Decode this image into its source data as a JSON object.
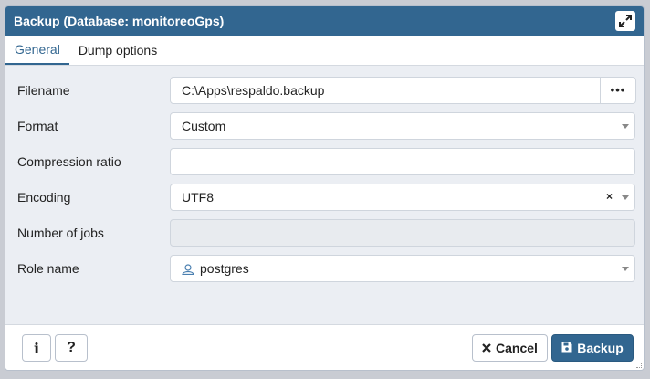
{
  "dialog": {
    "title": "Backup (Database: monitoreoGps)"
  },
  "tabs": [
    {
      "label": "General"
    },
    {
      "label": "Dump options"
    }
  ],
  "form": {
    "filename": {
      "label": "Filename",
      "value": "C:\\Apps\\respaldo.backup",
      "browse_label": "•••"
    },
    "format": {
      "label": "Format",
      "value": "Custom"
    },
    "compression": {
      "label": "Compression ratio",
      "value": ""
    },
    "encoding": {
      "label": "Encoding",
      "value": "UTF8",
      "clear_label": "×"
    },
    "jobs": {
      "label": "Number of jobs",
      "value": ""
    },
    "role": {
      "label": "Role name",
      "value": "postgres"
    }
  },
  "footer": {
    "info_label": "i",
    "help_label": "?",
    "cancel_label": "Cancel",
    "backup_label": "Backup"
  },
  "colors": {
    "accent": "#326690",
    "background": "#ebeef3"
  }
}
